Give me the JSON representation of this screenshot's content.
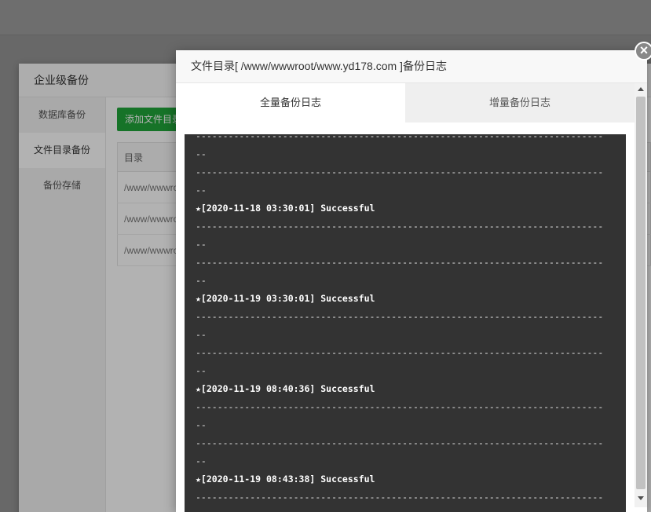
{
  "modal1": {
    "title": "企业级备份",
    "sidebar": [
      "数据库备份",
      "文件目录备份",
      "备份存储"
    ],
    "add_button": "添加文件目录",
    "table_header": "目录",
    "rows": [
      "/www/wwwroot",
      "/www/wwwroot",
      "/www/wwwroot"
    ]
  },
  "modal2": {
    "title": "文件目录[ /www/wwwroot/www.yd178.com ]备份日志",
    "close_label": "×",
    "tabs": [
      "全量备份日志",
      "增量备份日志"
    ],
    "log_lines": [
      "---------------------------------------------------------------------------",
      "--",
      "---------------------------------------------------------------------------",
      "--",
      "★[2020-11-18 03:30:01] Successful",
      "---------------------------------------------------------------------------",
      "--",
      "---------------------------------------------------------------------------",
      "--",
      "★[2020-11-19 03:30:01] Successful",
      "---------------------------------------------------------------------------",
      "--",
      "---------------------------------------------------------------------------",
      "--",
      "★[2020-11-19 08:40:36] Successful",
      "---------------------------------------------------------------------------",
      "--",
      "---------------------------------------------------------------------------",
      "--",
      "★[2020-11-19 08:43:38] Successful",
      "---------------------------------------------------------------------------"
    ]
  }
}
